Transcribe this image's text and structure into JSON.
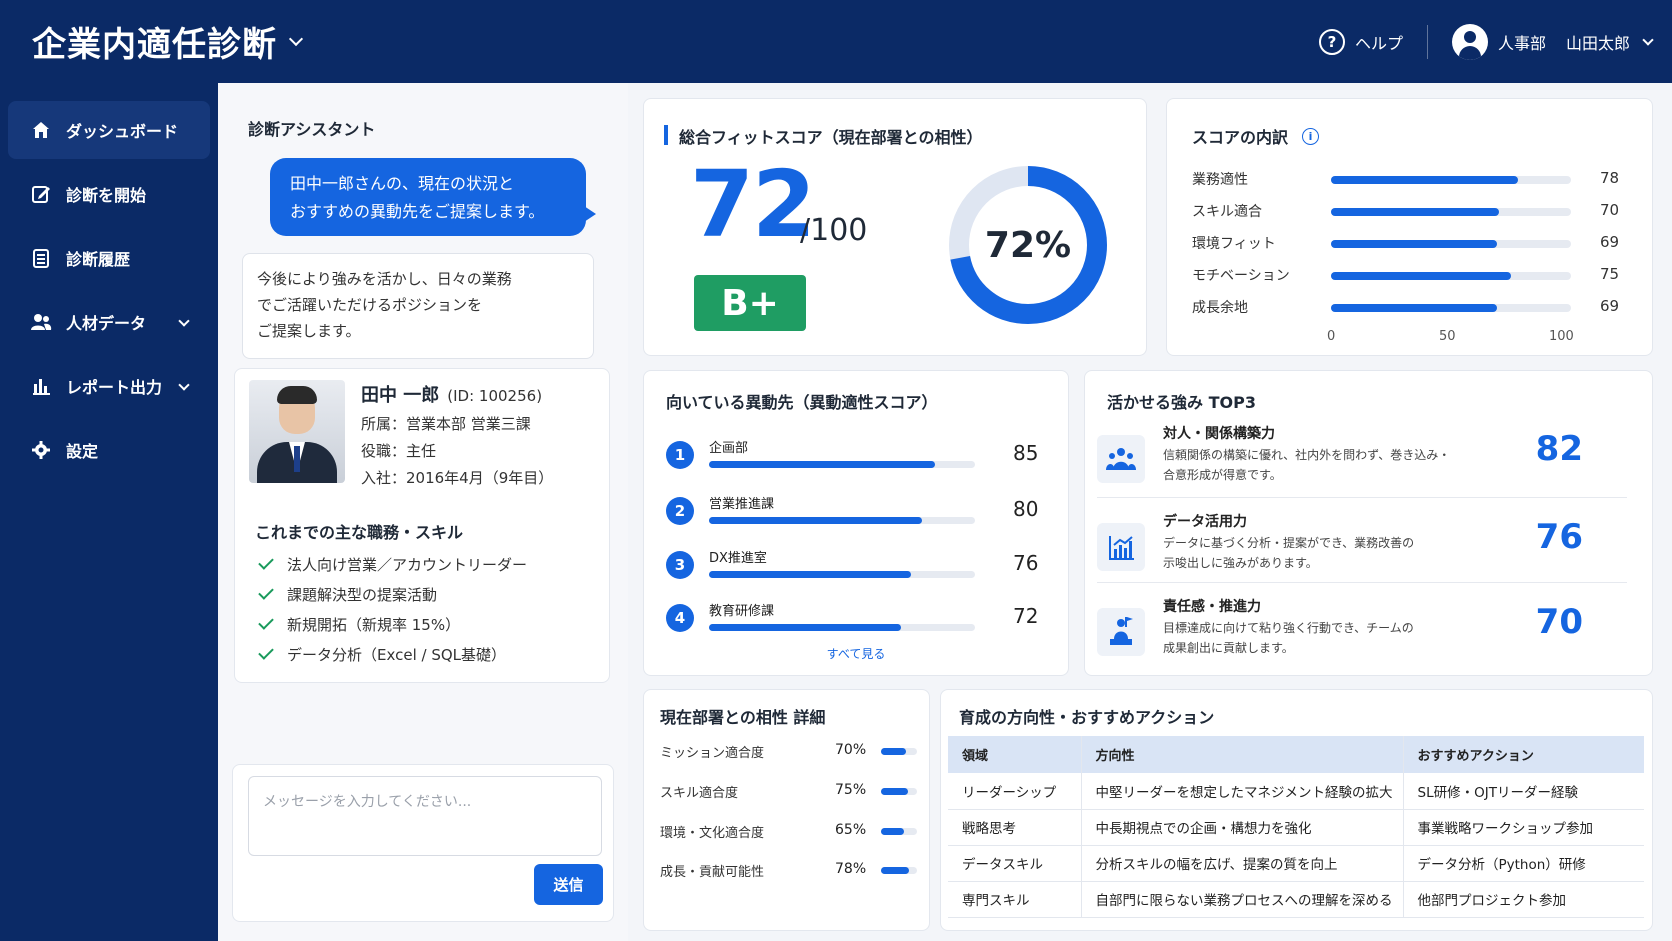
{
  "header": {
    "app_title": "企業内適任診断",
    "help_label": "ヘルプ",
    "department": "人事部",
    "user_name": "山田太郎"
  },
  "sidebar": {
    "items": [
      {
        "label": "ダッシュボード",
        "icon": "home-icon",
        "active": true
      },
      {
        "label": "診断を開始",
        "icon": "edit-icon"
      },
      {
        "label": "診断履歴",
        "icon": "document-list-icon"
      },
      {
        "label": "人材データ",
        "icon": "people-icon",
        "expandable": true
      },
      {
        "label": "レポート出力",
        "icon": "bar-chart-icon",
        "expandable": true
      },
      {
        "label": "設定",
        "icon": "gear-icon"
      }
    ]
  },
  "assistant": {
    "title": "診断アシスタント",
    "bubble_line1": "田中一郎さんの、現在の状況と",
    "bubble_line2": "おすすめの異動先をご提案します。",
    "reply_line1": "今後により強みを活かし、日々の業務",
    "reply_line2": "でご活躍いただけるポジションを",
    "reply_line3": "ご提案します。",
    "input_placeholder": "メッセージを入力してください...",
    "send_label": "送信"
  },
  "profile": {
    "name": "田中 一郎",
    "id": "(ID: 100256)",
    "affiliation": "所属：営業本部 営業三課",
    "position": "役職：主任",
    "joined": "入社：2016年4月（9年目）",
    "skills_title": "これまでの主な職務・スキル",
    "skills": [
      "法人向け営業／アカウントリーダー",
      "課題解決型の提案活動",
      "新規開拓（新規率 15%）",
      "データ分析（Excel / SQL基礎）"
    ]
  },
  "fit_score": {
    "title": "総合フィットスコア（現在部署との相性）",
    "score": "72",
    "max": "/100",
    "grade": "B+",
    "percent_label": "72%",
    "percent_value": 72
  },
  "breakdown": {
    "title": "スコアの内訳",
    "items": [
      {
        "label": "業務適性",
        "value": 78
      },
      {
        "label": "スキル適合",
        "value": 70
      },
      {
        "label": "環境フィット",
        "value": 69
      },
      {
        "label": "モチベーション",
        "value": 75
      },
      {
        "label": "成長余地",
        "value": 69
      }
    ],
    "ticks": [
      "0",
      "50",
      "100"
    ]
  },
  "transfer": {
    "title": "向いている異動先（異動適性スコア）",
    "items": [
      {
        "rank": "1",
        "name": "企画部",
        "value": 85
      },
      {
        "rank": "2",
        "name": "営業推進課",
        "value": 80
      },
      {
        "rank": "3",
        "name": "DX推進室",
        "value": 76
      },
      {
        "rank": "4",
        "name": "教育研修課",
        "value": 72
      }
    ],
    "see_all": "すべて見る"
  },
  "strengths": {
    "title": "活かせる強み TOP3",
    "items": [
      {
        "name": "対人・関係構築力",
        "desc1": "信頼関係の構築に優れ、社内外を問わず、巻き込み・",
        "desc2": "合意形成が得意です。",
        "score": "82",
        "icon": "team-icon"
      },
      {
        "name": "データ活用力",
        "desc1": "データに基づく分析・提案ができ、業務改善の",
        "desc2": "示唆出しに強みがあります。",
        "score": "76",
        "icon": "analytics-chart-icon"
      },
      {
        "name": "責任感・推進力",
        "desc1": "目標達成に向けて粘り強く行動でき、チームの",
        "desc2": "成果創出に貢献します。",
        "score": "70",
        "icon": "leader-icon"
      }
    ]
  },
  "compatibility": {
    "title": "現在部署との相性 詳細",
    "items": [
      {
        "label": "ミッション適合度",
        "pct_label": "70%",
        "value": 70
      },
      {
        "label": "スキル適合度",
        "pct_label": "75%",
        "value": 75
      },
      {
        "label": "環境・文化適合度",
        "pct_label": "65%",
        "value": 65
      },
      {
        "label": "成長・貢献可能性",
        "pct_label": "78%",
        "value": 78
      }
    ]
  },
  "development": {
    "title": "育成の方向性・おすすめアクション",
    "headers": [
      "領域",
      "方向性",
      "おすすめアクション"
    ],
    "rows": [
      [
        "リーダーシップ",
        "中堅リーダーを想定したマネジメント経験の拡大",
        "SL研修・OJTリーダー経験"
      ],
      [
        "戦略思考",
        "中長期視点での企画・構想力を強化",
        "事業戦略ワークショップ参加"
      ],
      [
        "データスキル",
        "分析スキルの幅を広げ、提案の質を向上",
        "データ分析（Python）研修"
      ],
      [
        "専門スキル",
        "自部門に限らない業務プロセスへの理解を深める",
        "他部門プロジェクト参加"
      ]
    ]
  },
  "colors": {
    "navy": "#0b2a66",
    "accent": "#1565e0",
    "grade_green": "#1f9d63"
  }
}
